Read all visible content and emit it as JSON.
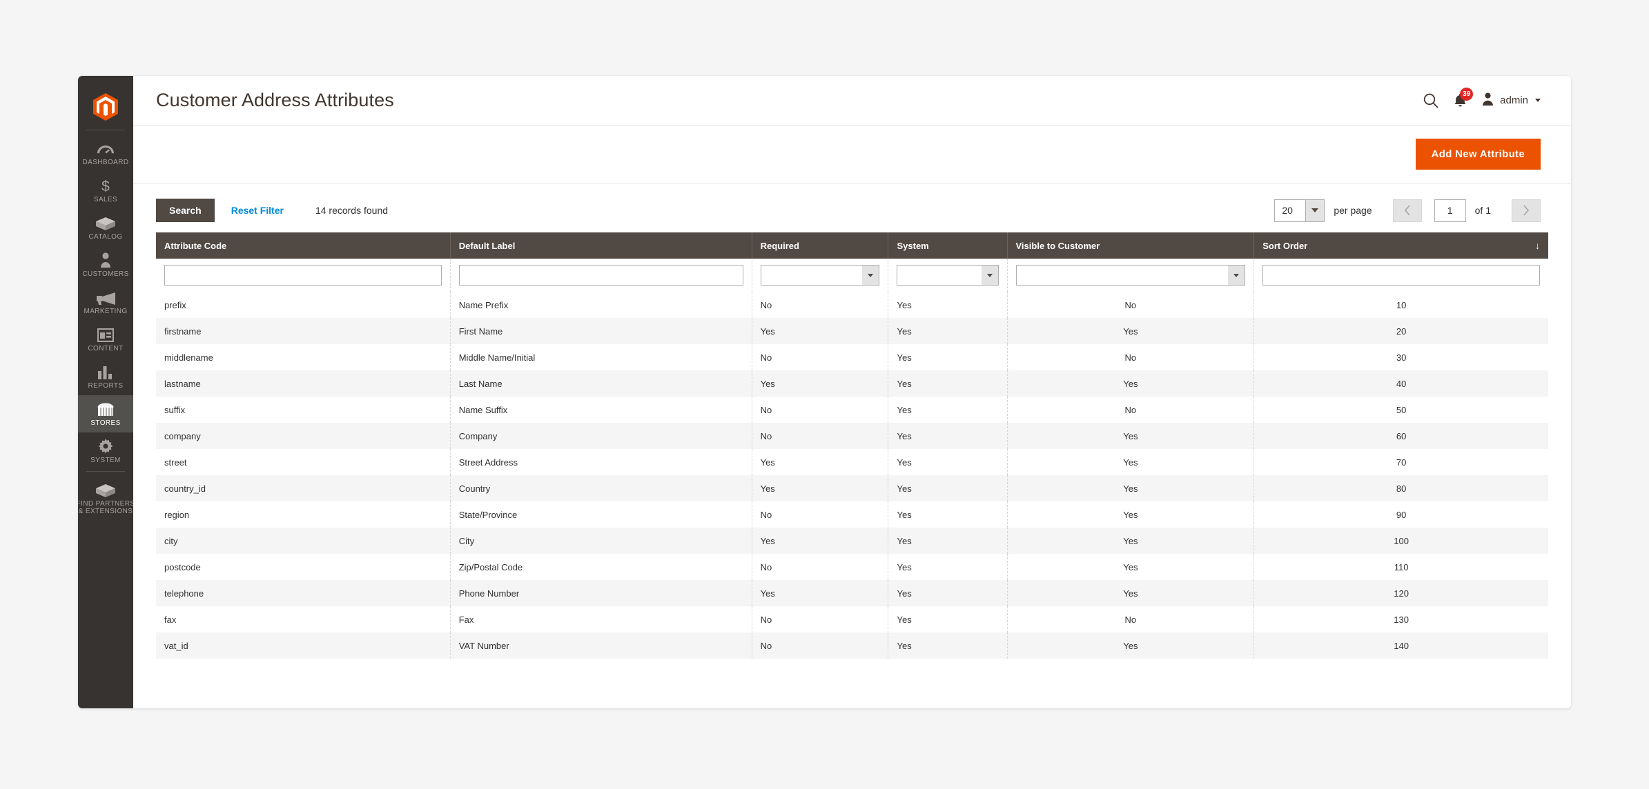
{
  "header": {
    "title": "Customer Address Attributes",
    "search_icon": "search-icon",
    "bell_icon": "notification-bell-icon",
    "notification_count": "39",
    "user_icon": "user-avatar-icon",
    "admin_name": "admin"
  },
  "actions": {
    "add_new_attribute": "Add New Attribute"
  },
  "toolbar": {
    "search_label": "Search",
    "reset_filter_label": "Reset Filter",
    "records_found": "14 records found",
    "per_page_value": "20",
    "per_page_label": "per page",
    "prev_icon": "chevron-left-icon",
    "next_icon": "chevron-right-icon",
    "current_page": "1",
    "of_pages": "of 1"
  },
  "sidebar": {
    "logo": "magento-logo-icon",
    "items": [
      {
        "label": "DASHBOARD",
        "icon": "dashboard-icon",
        "active": false
      },
      {
        "label": "SALES",
        "icon": "dollar-icon",
        "active": false
      },
      {
        "label": "CATALOG",
        "icon": "box-icon",
        "active": false
      },
      {
        "label": "CUSTOMERS",
        "icon": "person-icon",
        "active": false
      },
      {
        "label": "MARKETING",
        "icon": "megaphone-icon",
        "active": false
      },
      {
        "label": "CONTENT",
        "icon": "layout-icon",
        "active": false
      },
      {
        "label": "REPORTS",
        "icon": "bar-chart-icon",
        "active": false
      },
      {
        "label": "STORES",
        "icon": "storefront-icon",
        "active": true
      },
      {
        "label": "SYSTEM",
        "icon": "gear-icon",
        "active": false
      },
      {
        "label": "FIND PARTNERS & EXTENSIONS",
        "icon": "box-icon",
        "active": false
      }
    ]
  },
  "grid": {
    "columns": [
      {
        "label": "Attribute Code",
        "filter": "input"
      },
      {
        "label": "Default Label",
        "filter": "input"
      },
      {
        "label": "Required",
        "filter": "select"
      },
      {
        "label": "System",
        "filter": "select"
      },
      {
        "label": "Visible to Customer",
        "filter": "select"
      },
      {
        "label": "Sort Order",
        "filter": "input",
        "sorted": "desc",
        "sort_glyph": "↓"
      }
    ],
    "filters": {
      "attribute_code": "",
      "default_label": "",
      "required": "",
      "system": "",
      "visible_to_customer": "",
      "sort_order": ""
    },
    "rows": [
      {
        "attribute_code": "prefix",
        "default_label": "Name Prefix",
        "required": "No",
        "system": "Yes",
        "visible": "No",
        "sort_order": "10"
      },
      {
        "attribute_code": "firstname",
        "default_label": "First Name",
        "required": "Yes",
        "system": "Yes",
        "visible": "Yes",
        "sort_order": "20"
      },
      {
        "attribute_code": "middlename",
        "default_label": "Middle Name/Initial",
        "required": "No",
        "system": "Yes",
        "visible": "No",
        "sort_order": "30"
      },
      {
        "attribute_code": "lastname",
        "default_label": "Last Name",
        "required": "Yes",
        "system": "Yes",
        "visible": "Yes",
        "sort_order": "40"
      },
      {
        "attribute_code": "suffix",
        "default_label": "Name Suffix",
        "required": "No",
        "system": "Yes",
        "visible": "No",
        "sort_order": "50"
      },
      {
        "attribute_code": "company",
        "default_label": "Company",
        "required": "No",
        "system": "Yes",
        "visible": "Yes",
        "sort_order": "60"
      },
      {
        "attribute_code": "street",
        "default_label": "Street Address",
        "required": "Yes",
        "system": "Yes",
        "visible": "Yes",
        "sort_order": "70"
      },
      {
        "attribute_code": "country_id",
        "default_label": "Country",
        "required": "Yes",
        "system": "Yes",
        "visible": "Yes",
        "sort_order": "80"
      },
      {
        "attribute_code": "region",
        "default_label": "State/Province",
        "required": "No",
        "system": "Yes",
        "visible": "Yes",
        "sort_order": "90"
      },
      {
        "attribute_code": "city",
        "default_label": "City",
        "required": "Yes",
        "system": "Yes",
        "visible": "Yes",
        "sort_order": "100"
      },
      {
        "attribute_code": "postcode",
        "default_label": "Zip/Postal Code",
        "required": "No",
        "system": "Yes",
        "visible": "Yes",
        "sort_order": "110"
      },
      {
        "attribute_code": "telephone",
        "default_label": "Phone Number",
        "required": "Yes",
        "system": "Yes",
        "visible": "Yes",
        "sort_order": "120"
      },
      {
        "attribute_code": "fax",
        "default_label": "Fax",
        "required": "No",
        "system": "Yes",
        "visible": "No",
        "sort_order": "130"
      },
      {
        "attribute_code": "vat_id",
        "default_label": "VAT Number",
        "required": "No",
        "system": "Yes",
        "visible": "Yes",
        "sort_order": "140"
      }
    ]
  },
  "colors": {
    "accent": "#eb5202",
    "header_bar": "#514943",
    "sidebar": "#373330",
    "link": "#008bdb",
    "badge": "#e22626"
  }
}
